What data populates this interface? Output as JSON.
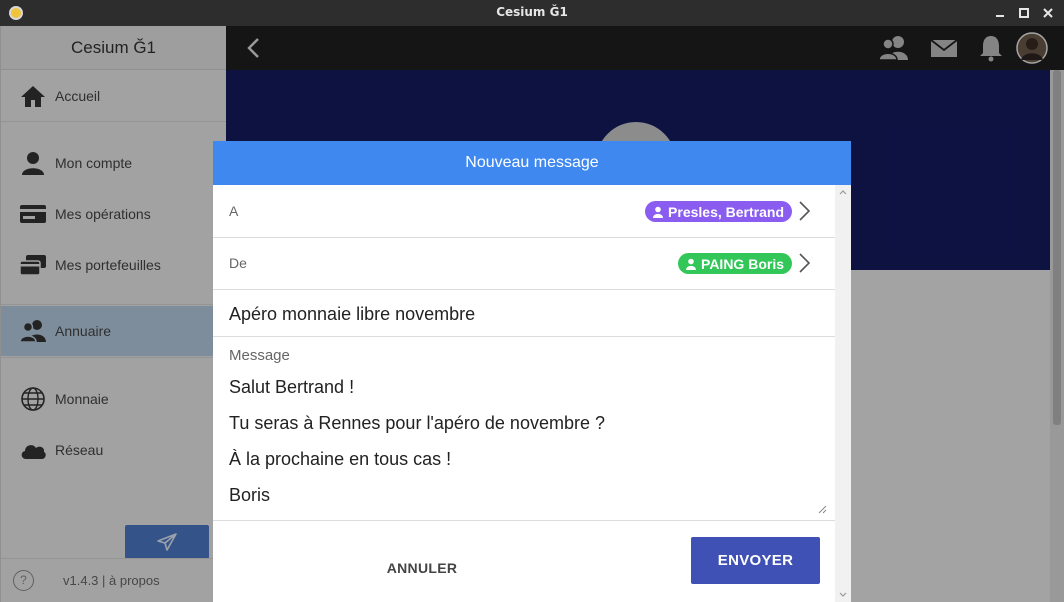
{
  "window": {
    "title": "Cesium Ğ1"
  },
  "sidebar": {
    "header": "Cesium Ğ1",
    "items": [
      {
        "label": "Accueil",
        "icon": "home-icon"
      },
      {
        "label": "Mon compte",
        "icon": "person-icon"
      },
      {
        "label": "Mes opérations",
        "icon": "card-icon"
      },
      {
        "label": "Mes portefeuilles",
        "icon": "cards-icon"
      },
      {
        "label": "Annuaire",
        "icon": "people-icon"
      },
      {
        "label": "Monnaie",
        "icon": "globe-icon"
      },
      {
        "label": "Réseau",
        "icon": "cloud-icon"
      }
    ],
    "active_item": "Annuaire",
    "footer": {
      "help": "?",
      "version": "v1.4.3 | à propos"
    }
  },
  "modal": {
    "title": "Nouveau message",
    "to_label": "A",
    "to_value": "Presles, Bertrand",
    "from_label": "De",
    "from_value": "PAING Boris",
    "subject": "Apéro monnaie libre novembre",
    "message_label": "Message",
    "message_lines": [
      "Salut Bertrand !",
      "Tu seras à Rennes pour l'apéro de novembre ?",
      "À la prochaine en tous cas !",
      "Boris"
    ],
    "cancel_label": "ANNULER",
    "send_label": "ENVOYER"
  },
  "colors": {
    "modal_header": "#3f88f0",
    "to_chip": "#8a5cf0",
    "from_chip": "#33c759",
    "send_button": "#3f51b5",
    "banner": "#141a5e"
  }
}
